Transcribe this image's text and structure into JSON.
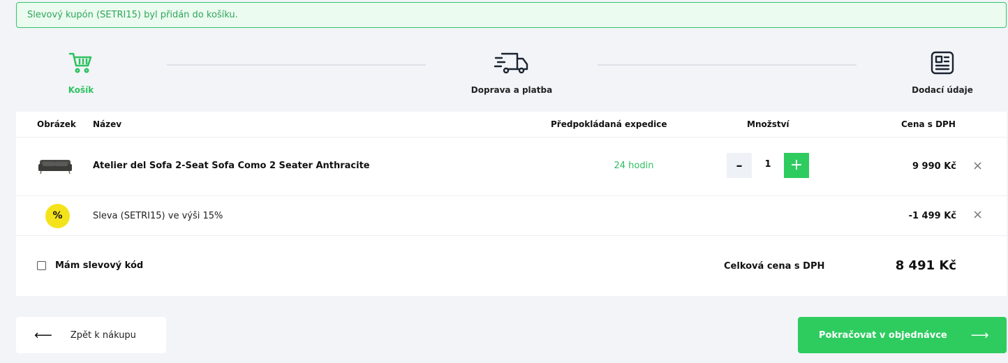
{
  "alert": {
    "text": "Slevový kupón (SETRI15) byl přidán do košíku."
  },
  "steps": [
    {
      "label": "Košík"
    },
    {
      "label": "Doprava a platba"
    },
    {
      "label": "Dodací údaje"
    }
  ],
  "table": {
    "headers": {
      "image": "Obrázek",
      "name": "Název",
      "expedition": "Předpokládaná expedice",
      "quantity": "Množství",
      "price": "Cena s DPH"
    },
    "product": {
      "name": "Atelier del Sofa 2-Seat Sofa Como 2 Seater Anthracite",
      "expedition": "24 hodin",
      "quantity": "1",
      "minus": "–",
      "plus": "+",
      "price": "9 990 Kč",
      "remove": "×"
    },
    "discount": {
      "badge": "%",
      "name": "Sleva (SETRI15) ve výši 15%",
      "price": "-1 499 Kč",
      "remove": "×"
    },
    "footer": {
      "coupon_label": "Mám slevový kód",
      "total_label": "Celková cena s DPH",
      "total_value": "8 491 Kč"
    }
  },
  "buttons": {
    "back_arrow": "⟵",
    "back": "Zpět k nákupu",
    "continue": "Pokračovat v objednávce",
    "continue_arrow": "⟶"
  },
  "colors": {
    "accent": "#2ecc5f",
    "badge": "#f4e31a",
    "background": "#f2f4f8"
  }
}
